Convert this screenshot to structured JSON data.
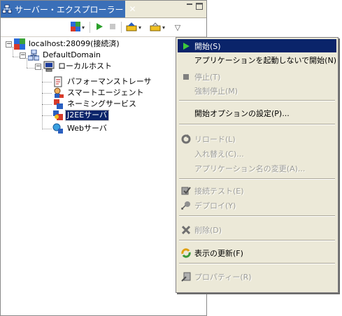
{
  "view": {
    "tab_title": "サーバー・エクスプローラー",
    "close_glyph": "✕",
    "minimize_glyph": "▭",
    "maximize_glyph": "▢"
  },
  "toolbar": {
    "layout_icon": "layout-icon",
    "run_icon": "run-icon",
    "stop_icon": "stop-icon",
    "tool1_icon": "deploy-tool-icon",
    "tool2_icon": "folder-tool-icon",
    "dropdown_glyph": "▾",
    "view_menu_glyph": "▽"
  },
  "tree": {
    "root": {
      "label": "localhost:28099(接続済)",
      "expand": "−"
    },
    "domain": {
      "label": "DefaultDomain",
      "expand": "−"
    },
    "host": {
      "label": "ローカルホスト",
      "expand": "−"
    },
    "children": [
      {
        "label": "パフォーマンストレーサ"
      },
      {
        "label": "スマートエージェント"
      },
      {
        "label": "ネーミングサービス"
      },
      {
        "label": "J2EEサーバ"
      },
      {
        "label": "Webサーバ"
      }
    ]
  },
  "context_menu": {
    "items": [
      {
        "label": "開始(S)",
        "icon": "start-icon"
      },
      {
        "label": "アプリケーションを起動しないで開始(N)"
      },
      {
        "label": "停止(T)",
        "icon": "stop-icon"
      },
      {
        "label": "強制停止(M)"
      },
      {
        "label": "開始オプションの設定(P)..."
      },
      {
        "label": "リロード(L)",
        "icon": "reload-icon"
      },
      {
        "label": "入れ替え(C)..."
      },
      {
        "label": "アプリケーション名の変更(A)..."
      },
      {
        "label": "接続テスト(E)",
        "icon": "connection-test-icon"
      },
      {
        "label": "デプロイ(Y)",
        "icon": "deploy-icon"
      },
      {
        "label": "削除(D)",
        "icon": "delete-icon"
      },
      {
        "label": "表示の更新(F)",
        "icon": "refresh-icon"
      },
      {
        "label": "プロパティー(R)",
        "icon": "properties-icon"
      }
    ]
  },
  "colors": {
    "selection": "#0a246a",
    "menu_bg": "#ece9d8",
    "tab_bg": "#3a6fb8",
    "disabled_text": "#9d9d98"
  }
}
